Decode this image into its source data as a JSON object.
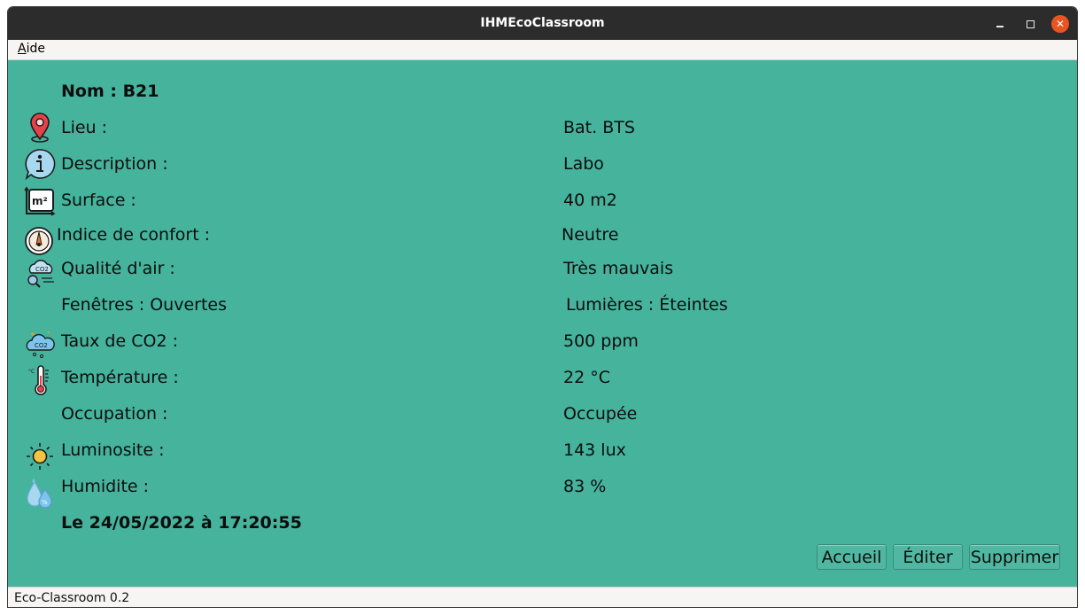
{
  "window": {
    "title": "IHMEcoClassroom"
  },
  "menu": {
    "aide_mnemonic": "A",
    "aide_rest": "ide"
  },
  "room": {
    "nom": "Nom : B21",
    "lieu": {
      "label": "Lieu :",
      "value": "Bat. BTS",
      "icon": "location-pin-icon"
    },
    "description": {
      "label": "Description  :",
      "value": "Labo",
      "icon": "info-icon"
    },
    "surface": {
      "label": "Surface :",
      "value": "40 m2",
      "icon": "m2-area-icon"
    },
    "confort": {
      "label": "Indice de confort :",
      "value": "Neutre",
      "icon": "comfort-gauge-icon"
    },
    "qualite_air": {
      "label": "Qualité d'air :",
      "value": "Très mauvais",
      "icon": "air-quality-icon"
    },
    "fenetres": {
      "label": "Fenêtres : Ouvertes"
    },
    "lumieres": {
      "label": "Lumières : Éteintes"
    },
    "co2": {
      "label": "Taux de CO2 :",
      "value": "500 ppm",
      "icon": "co2-cloud-icon"
    },
    "temperature": {
      "label": "Température :",
      "value": "22 °C",
      "icon": "thermometer-icon"
    },
    "occupation": {
      "label": "Occupation :",
      "value": "Occupée"
    },
    "luminosite": {
      "label": "Luminosite :",
      "value": "143 lux",
      "icon": "sun-icon"
    },
    "humidite": {
      "label": "Humidite :",
      "value": "83 %",
      "icon": "humidity-drop-icon"
    },
    "date": "Le 24/05/2022 à 17:20:55"
  },
  "buttons": {
    "accueil": "Accueil",
    "editer": "Éditer",
    "supprimer": "Supprimer"
  },
  "status": {
    "text": "Eco-Classroom 0.2"
  },
  "colors": {
    "content_bg": "#46b39d",
    "titlebar_bg": "#2c2c2c",
    "close_button": "#e95420"
  }
}
